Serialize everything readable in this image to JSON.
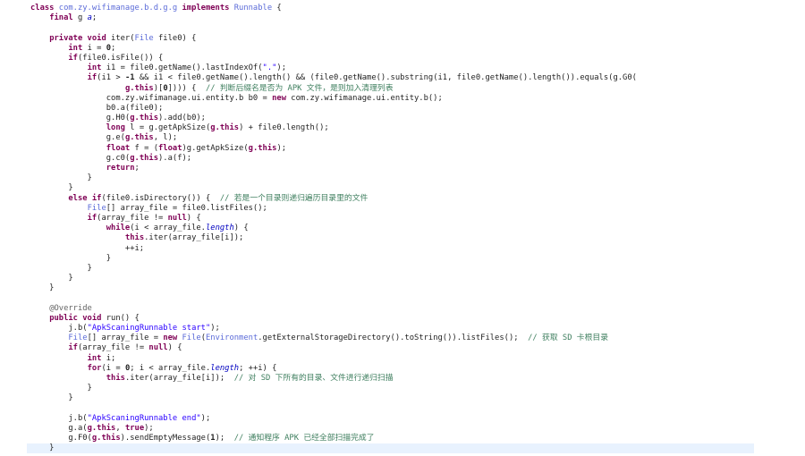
{
  "editor": {
    "current_line_index": 44,
    "lines": [
      [
        [
          "kw",
          "class "
        ],
        [
          "cls",
          "com.zy.wifimanage.b.d.g.g "
        ],
        [
          "kw",
          "implements "
        ],
        [
          "cls",
          "Runnable"
        ],
        [
          "txt",
          " {"
        ]
      ],
      [
        [
          "txt",
          "    "
        ],
        [
          "kw",
          "final "
        ],
        [
          "txt",
          "g "
        ],
        [
          "field",
          "a"
        ],
        [
          "txt",
          ";"
        ]
      ],
      [
        [
          "txt",
          ""
        ]
      ],
      [
        [
          "txt",
          "    "
        ],
        [
          "kw",
          "private void "
        ],
        [
          "txt",
          "iter("
        ],
        [
          "cls",
          "File "
        ],
        [
          "txt",
          "file0) {"
        ]
      ],
      [
        [
          "txt",
          "        "
        ],
        [
          "kw",
          "int "
        ],
        [
          "txt",
          "i = "
        ],
        [
          "num",
          "0"
        ],
        [
          "txt",
          ";"
        ]
      ],
      [
        [
          "txt",
          "        "
        ],
        [
          "kw",
          "if"
        ],
        [
          "txt",
          "(file0.isFile()) {"
        ]
      ],
      [
        [
          "txt",
          "            "
        ],
        [
          "kw",
          "int "
        ],
        [
          "txt",
          "i1 = file0.getName().lastIndexOf("
        ],
        [
          "str",
          "\".\""
        ],
        [
          "txt",
          ");"
        ]
      ],
      [
        [
          "txt",
          "            "
        ],
        [
          "kw",
          "if"
        ],
        [
          "txt",
          "(i1 > "
        ],
        [
          "num",
          "-1"
        ],
        [
          "txt",
          " && i1 < file0.getName().length() && (file0.getName().substring(i1, file0.getName().length()).equals(g.G0("
        ]
      ],
      [
        [
          "txt",
          "                    "
        ],
        [
          "kw",
          "g.this"
        ],
        [
          "txt",
          ")["
        ],
        [
          "num",
          "0"
        ],
        [
          "txt",
          "]))) {  "
        ],
        [
          "cmt",
          "// 判断后缀名是否为 APK 文件，是则加入清理列表"
        ]
      ],
      [
        [
          "txt",
          "                com.zy.wifimanage.ui.entity.b b0 = "
        ],
        [
          "kw",
          "new "
        ],
        [
          "txt",
          "com.zy.wifimanage.ui.entity.b();"
        ]
      ],
      [
        [
          "txt",
          "                b0.a(file0);"
        ]
      ],
      [
        [
          "txt",
          "                g.H0("
        ],
        [
          "kw",
          "g.this"
        ],
        [
          "txt",
          ").add(b0);"
        ]
      ],
      [
        [
          "txt",
          "                "
        ],
        [
          "kw",
          "long "
        ],
        [
          "txt",
          "l = g.getApkSize("
        ],
        [
          "kw",
          "g.this"
        ],
        [
          "txt",
          ") + file0.length();"
        ]
      ],
      [
        [
          "txt",
          "                g.e("
        ],
        [
          "kw",
          "g.this"
        ],
        [
          "txt",
          ", l);"
        ]
      ],
      [
        [
          "txt",
          "                "
        ],
        [
          "kw",
          "float "
        ],
        [
          "txt",
          "f = ("
        ],
        [
          "kw",
          "float"
        ],
        [
          "txt",
          ")g.getApkSize("
        ],
        [
          "kw",
          "g.this"
        ],
        [
          "txt",
          ");"
        ]
      ],
      [
        [
          "txt",
          "                g.c0("
        ],
        [
          "kw",
          "g.this"
        ],
        [
          "txt",
          ").a(f);"
        ]
      ],
      [
        [
          "txt",
          "                "
        ],
        [
          "kw",
          "return"
        ],
        [
          "txt",
          ";"
        ]
      ],
      [
        [
          "txt",
          "            }"
        ]
      ],
      [
        [
          "txt",
          "        }"
        ]
      ],
      [
        [
          "txt",
          "        "
        ],
        [
          "kw",
          "else if"
        ],
        [
          "txt",
          "(file0.isDirectory()) {  "
        ],
        [
          "cmt",
          "// 若是一个目录则递归遍历目录里的文件"
        ]
      ],
      [
        [
          "txt",
          "            "
        ],
        [
          "cls",
          "File"
        ],
        [
          "txt",
          "[] array_file = file0.listFiles();"
        ]
      ],
      [
        [
          "txt",
          "            "
        ],
        [
          "kw",
          "if"
        ],
        [
          "txt",
          "(array_file != "
        ],
        [
          "kw",
          "null"
        ],
        [
          "txt",
          ") {"
        ]
      ],
      [
        [
          "txt",
          "                "
        ],
        [
          "kw",
          "while"
        ],
        [
          "txt",
          "(i < array_file."
        ],
        [
          "field",
          "length"
        ],
        [
          "txt",
          ") {"
        ]
      ],
      [
        [
          "txt",
          "                    "
        ],
        [
          "kw",
          "this"
        ],
        [
          "txt",
          ".iter(array_file[i]);"
        ]
      ],
      [
        [
          "txt",
          "                    ++i;"
        ]
      ],
      [
        [
          "txt",
          "                }"
        ]
      ],
      [
        [
          "txt",
          "            }"
        ]
      ],
      [
        [
          "txt",
          "        }"
        ]
      ],
      [
        [
          "txt",
          "    }"
        ]
      ],
      [
        [
          "txt",
          ""
        ]
      ],
      [
        [
          "txt",
          "    "
        ],
        [
          "ann",
          "@Override"
        ]
      ],
      [
        [
          "txt",
          "    "
        ],
        [
          "kw",
          "public void "
        ],
        [
          "txt",
          "run() {"
        ]
      ],
      [
        [
          "txt",
          "        j.b("
        ],
        [
          "str",
          "\"ApkScaningRunnable start\""
        ],
        [
          "txt",
          ");"
        ]
      ],
      [
        [
          "txt",
          "        "
        ],
        [
          "cls",
          "File"
        ],
        [
          "txt",
          "[] array_file = "
        ],
        [
          "kw",
          "new "
        ],
        [
          "cls",
          "File"
        ],
        [
          "txt",
          "("
        ],
        [
          "cls",
          "Environment"
        ],
        [
          "txt",
          ".getExternalStorageDirectory().toString()).listFiles();  "
        ],
        [
          "cmt",
          "// 获取 SD 卡根目录"
        ]
      ],
      [
        [
          "txt",
          "        "
        ],
        [
          "kw",
          "if"
        ],
        [
          "txt",
          "(array_file != "
        ],
        [
          "kw",
          "null"
        ],
        [
          "txt",
          ") {"
        ]
      ],
      [
        [
          "txt",
          "            "
        ],
        [
          "kw",
          "int "
        ],
        [
          "txt",
          "i;"
        ]
      ],
      [
        [
          "txt",
          "            "
        ],
        [
          "kw",
          "for"
        ],
        [
          "txt",
          "(i = "
        ],
        [
          "num",
          "0"
        ],
        [
          "txt",
          "; i < array_file."
        ],
        [
          "field",
          "length"
        ],
        [
          "txt",
          "; ++i) {"
        ]
      ],
      [
        [
          "txt",
          "                "
        ],
        [
          "kw",
          "this"
        ],
        [
          "txt",
          ".iter(array_file[i]);  "
        ],
        [
          "cmt",
          "// 对 SD 下所有的目录、文件进行递归扫描"
        ]
      ],
      [
        [
          "txt",
          "            }"
        ]
      ],
      [
        [
          "txt",
          "        }"
        ]
      ],
      [
        [
          "txt",
          ""
        ]
      ],
      [
        [
          "txt",
          "        j.b("
        ],
        [
          "str",
          "\"ApkScaningRunnable end\""
        ],
        [
          "txt",
          ");"
        ]
      ],
      [
        [
          "txt",
          "        g.a("
        ],
        [
          "kw",
          "g.this"
        ],
        [
          "txt",
          ", "
        ],
        [
          "kw",
          "true"
        ],
        [
          "txt",
          ");"
        ]
      ],
      [
        [
          "txt",
          "        g.F0("
        ],
        [
          "kw",
          "g.this"
        ],
        [
          "txt",
          ").sendEmptyMessage("
        ],
        [
          "num",
          "1"
        ],
        [
          "txt",
          ");  "
        ],
        [
          "cmt",
          "// 通知程序 APK 已经全部扫描完成了"
        ]
      ],
      [
        [
          "txt",
          "    }"
        ]
      ]
    ]
  }
}
